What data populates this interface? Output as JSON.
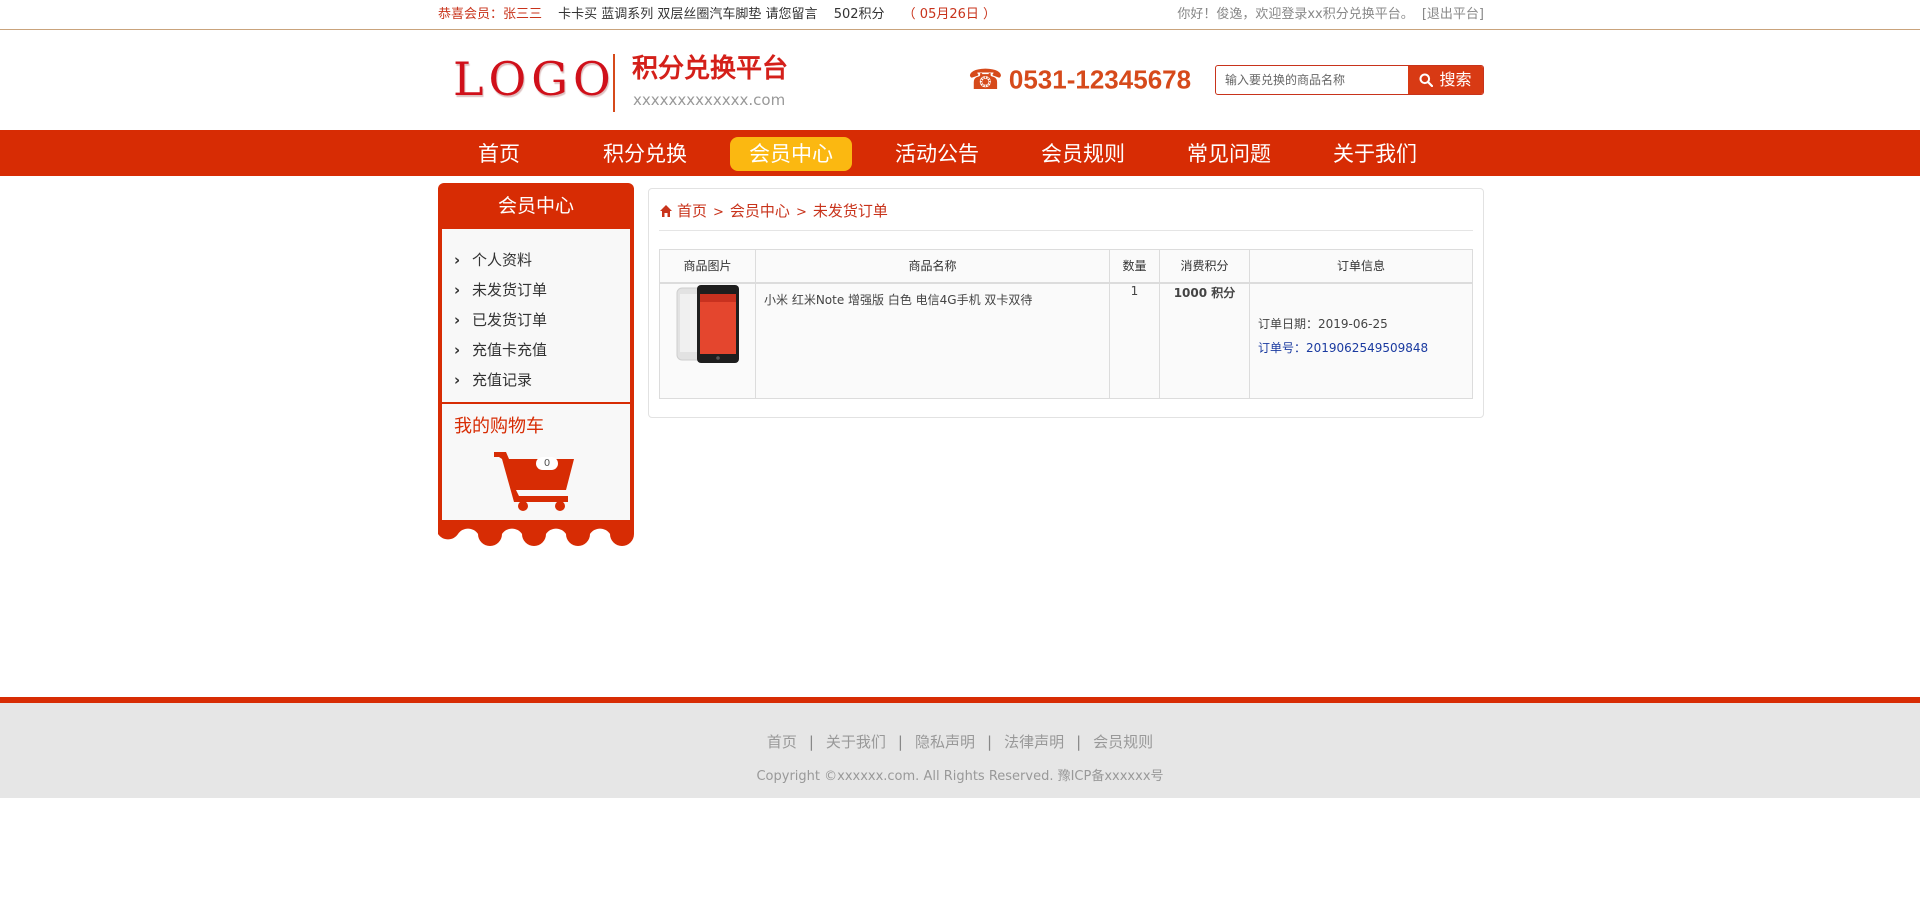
{
  "topbar": {
    "welcome": "恭喜会员：张三三",
    "marquee": "卡卡买 蓝调系列 双层丝圈汽车脚垫 请您留言",
    "points": "502积分",
    "date": "（ 05月26日 ）",
    "greeting": "你好！俊逸，欢迎登录xx积分兑换平台。",
    "logout": "[退出平台]"
  },
  "header": {
    "logo": "LOGO",
    "platform_title": "积分兑换平台",
    "platform_sub": "xxxxxxxxxxxxx.com",
    "phone_icon": "phone-icon",
    "phone": "0531-12345678",
    "search_placeholder": "输入要兑换的商品名称",
    "search_button": "搜索"
  },
  "nav": {
    "items": [
      {
        "label": "首页"
      },
      {
        "label": "积分兑换"
      },
      {
        "label": "会员中心",
        "active": true
      },
      {
        "label": "活动公告"
      },
      {
        "label": "会员规则"
      },
      {
        "label": "常见问题"
      },
      {
        "label": "关于我们"
      }
    ]
  },
  "sidebar": {
    "title": "会员中心",
    "items": [
      {
        "label": "个人资料"
      },
      {
        "label": "未发货订单"
      },
      {
        "label": "已发货订单"
      },
      {
        "label": "充值卡充值"
      },
      {
        "label": "充值记录"
      }
    ],
    "cart_title": "我的购物车",
    "cart_count": "0"
  },
  "breadcrumb": {
    "home": "首页",
    "level2": "会员中心",
    "current": "未发货订单",
    "separator": ">"
  },
  "orders": {
    "headers": [
      "商品图片",
      "商品名称",
      "数量",
      "消费积分",
      "订单信息"
    ],
    "rows": [
      {
        "product_name": "小米 红米Note 增强版 白色 电信4G手机 双卡双待",
        "quantity": "1",
        "points": "1000 积分",
        "date": "订单日期：2019-06-25",
        "order_no": "订单号：2019062549509848"
      }
    ]
  },
  "footer": {
    "links": [
      {
        "label": "首页"
      },
      {
        "label": "关于我们"
      },
      {
        "label": "隐私声明"
      },
      {
        "label": "法律声明"
      },
      {
        "label": "会员规则"
      }
    ],
    "separator": "|",
    "copyright": "Copyright ©xxxxxx.com. All Rights Reserved. 豫ICP备xxxxxx号"
  },
  "colors": {
    "brand_red": "#d72c04",
    "nav_active": "#fbb811",
    "link_red": "#c8331b",
    "points_blue": "#1a1aa0"
  }
}
